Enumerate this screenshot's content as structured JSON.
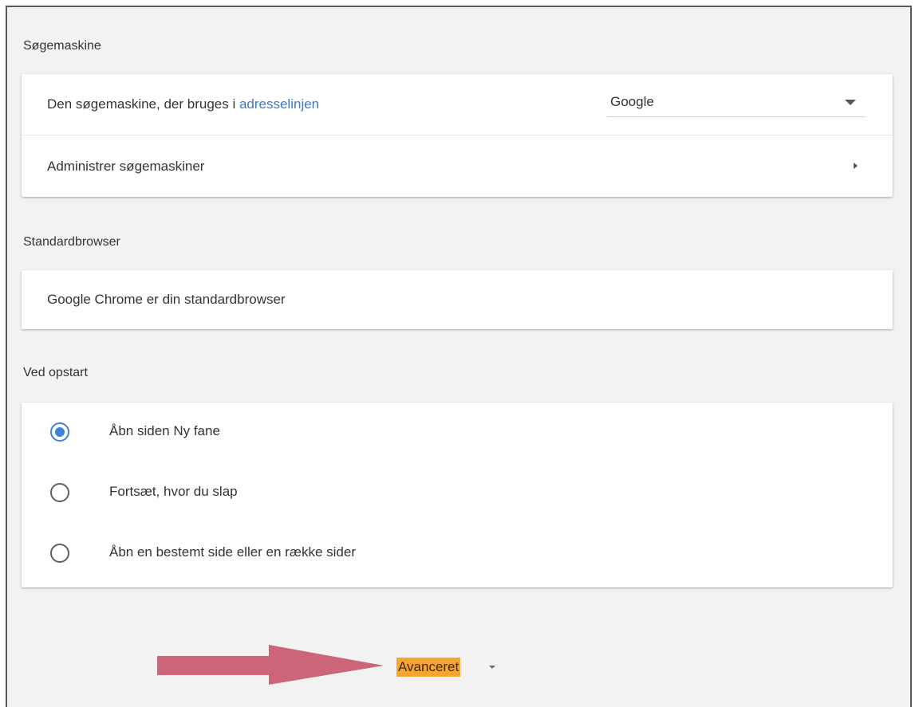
{
  "search_engine": {
    "section_title": "Søgemaskine",
    "row1_text": "Den søgemaskine, der bruges i ",
    "row1_link": "adresselinjen",
    "selected_engine": "Google",
    "manage_label": "Administrer søgemaskiner"
  },
  "default_browser": {
    "section_title": "Standardbrowser",
    "status_text": "Google Chrome er din standardbrowser"
  },
  "on_startup": {
    "section_title": "Ved opstart",
    "options": [
      {
        "label": "Åbn siden Ny fane",
        "checked": true
      },
      {
        "label": "Fortsæt, hvor du slap",
        "checked": false
      },
      {
        "label": "Åbn en bestemt side eller en række sider",
        "checked": false
      }
    ]
  },
  "advanced": {
    "label": "Avanceret",
    "highlight_color": "#f7a531"
  },
  "icons": {
    "dropdown": "chevron-down-icon",
    "submenu": "chevron-right-icon",
    "pointer": "arrow-right-icon"
  },
  "colors": {
    "accent": "#3f7fe0",
    "link": "#3b78c7",
    "annotation_arrow": "#cc6577"
  }
}
